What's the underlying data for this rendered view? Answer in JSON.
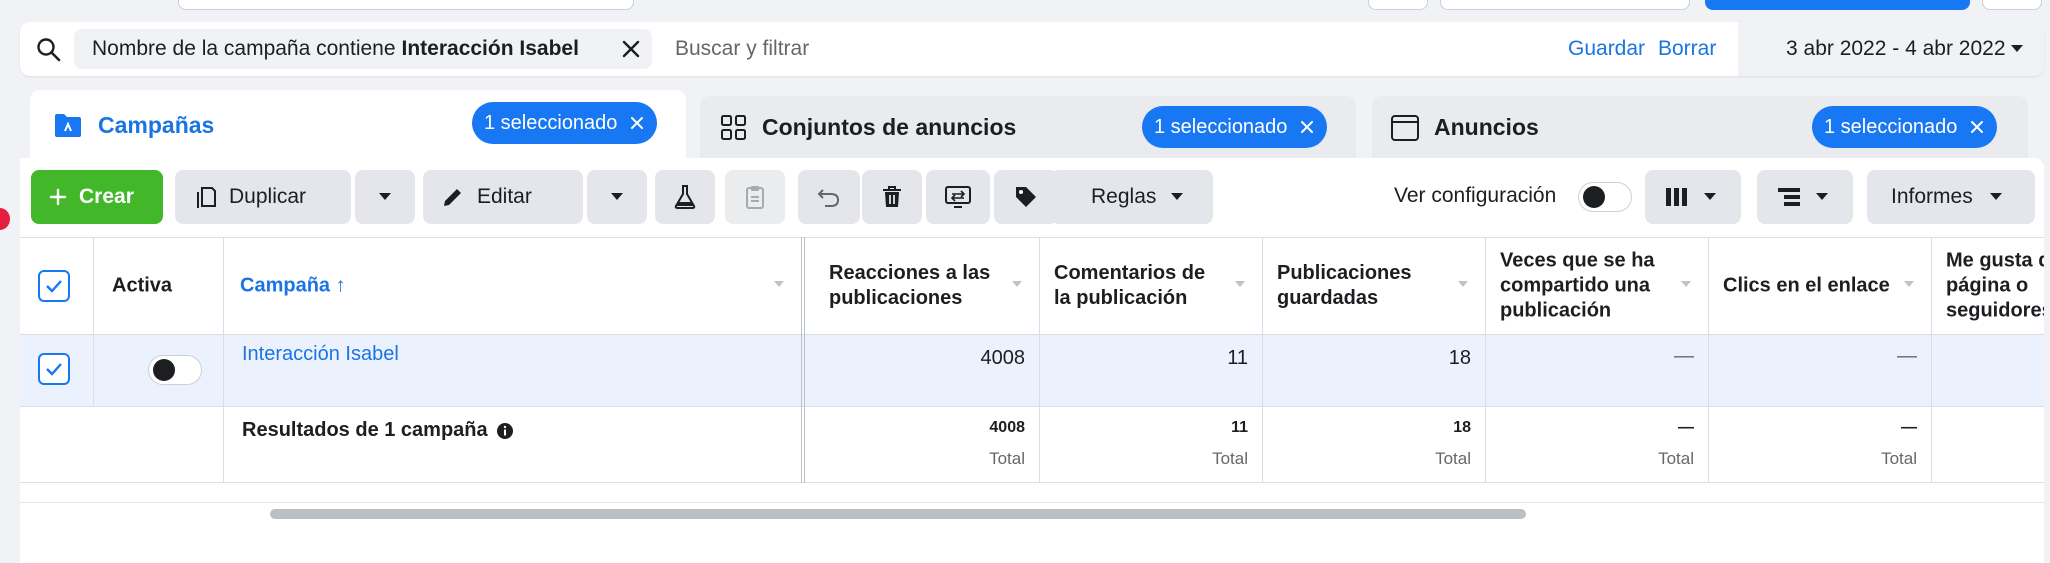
{
  "filter": {
    "chip_prefix": "Nombre de la campaña contiene",
    "chip_value": "Interacción Isabel",
    "placeholder": "Buscar y filtrar",
    "save": "Guardar",
    "clear": "Borrar",
    "date_range": "3 abr 2022 - 4 abr 2022"
  },
  "tabs": [
    {
      "label": "Campañas",
      "selected": "1 seleccionado"
    },
    {
      "label": "Conjuntos de anuncios",
      "selected": "1 seleccionado"
    },
    {
      "label": "Anuncios",
      "selected": "1 seleccionado"
    }
  ],
  "toolbar": {
    "create": "Crear",
    "duplicate": "Duplicar",
    "edit": "Editar",
    "rules": "Reglas",
    "view_settings": "Ver configuración",
    "reports": "Informes"
  },
  "table": {
    "headers": {
      "active": "Activa",
      "campaign": "Campaña ↑",
      "reactions": [
        "Reacciones a las",
        "publicaciones"
      ],
      "comments": [
        "Comentarios de",
        "la publicación"
      ],
      "saved": [
        "Publicaciones",
        "guardadas"
      ],
      "shares": [
        "Veces que se ha",
        "compartido una",
        "publicación"
      ],
      "link_clicks": "Clics en el enlace",
      "page_likes": [
        "Me gusta de",
        "página o",
        "seguidores"
      ]
    },
    "row": {
      "campaign": "Interacción Isabel",
      "reactions": "4008",
      "comments": "11",
      "saved": "18",
      "shares": "—",
      "link_clicks": "—"
    },
    "totals": {
      "label": "Resultados de 1 campaña",
      "reactions": "4008",
      "comments": "11",
      "saved": "18",
      "shares": "—",
      "link_clicks": "—",
      "sub": "Total"
    }
  },
  "colors": {
    "accent": "#1877f2",
    "create": "#42b72a",
    "row_highlight": "#ebf2fd"
  }
}
